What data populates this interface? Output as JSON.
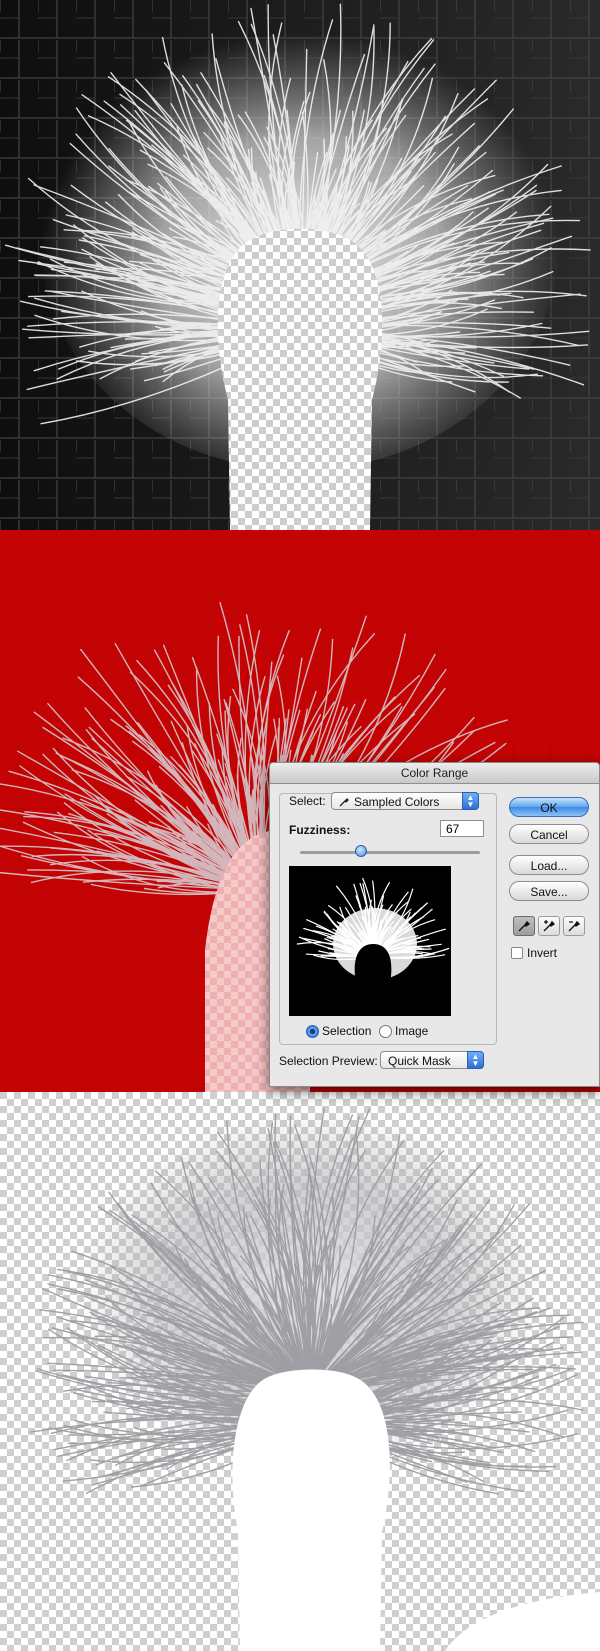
{
  "dialog": {
    "title": "Color Range",
    "select_label": "Select:",
    "select_value": "Sampled Colors",
    "fuzziness_label": "Fuzziness:",
    "fuzziness_value": "67",
    "fuzziness_level_percent": 33,
    "radio_selection": "Selection",
    "radio_image": "Image",
    "selected_radio": "Selection",
    "preview_label": "Selection Preview:",
    "preview_value": "Quick Mask",
    "buttons": {
      "ok": "OK",
      "cancel": "Cancel",
      "load": "Load...",
      "save": "Save..."
    },
    "invert_label": "Invert",
    "invert_checked": false
  },
  "colors": {
    "quick_mask": "#c40404",
    "leather_dark": "#1b1b1b",
    "fur": "#e9e9ee",
    "fur_extracted": "#a9a9ad",
    "accent_blue": "#3c8ae6"
  },
  "icons": [
    "eyedropper-icon",
    "eyedropper-plus-icon",
    "eyedropper-minus-icon",
    "popup-arrows-icon",
    "slider-thumb-icon"
  ]
}
